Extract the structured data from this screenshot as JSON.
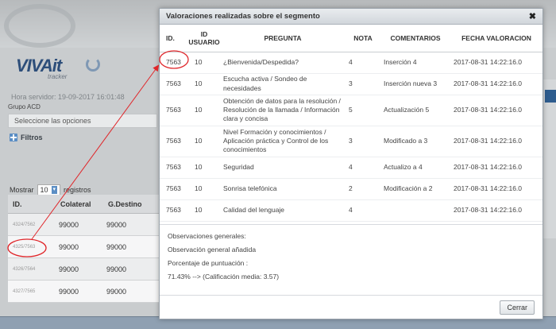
{
  "background": {
    "logo_main": "VIVAit",
    "logo_sub": "tracker",
    "server_time": "Hora servidor: 19-09-2017 16:01:48",
    "group_label": "Grupo ACD",
    "group_placeholder": "Seleccione las opciones",
    "filters_label": "Filtros",
    "show_prefix": "Mostrar",
    "show_value": "10",
    "show_suffix": "registros",
    "table_headers": [
      "ID.",
      "Colateral",
      "G.Destino"
    ],
    "rows": [
      {
        "id": "4324/7562",
        "colateral": "99000",
        "destino": "99000"
      },
      {
        "id": "4325/7563",
        "colateral": "99000",
        "destino": "99000"
      },
      {
        "id": "4326/7564",
        "colateral": "99000",
        "destino": "99000"
      },
      {
        "id": "4327/7565",
        "colateral": "99000",
        "destino": "99000"
      }
    ]
  },
  "modal": {
    "title": "Valoraciones realizadas sobre el segmento",
    "close_icon": "close-icon",
    "headers": {
      "id": "ID.",
      "user": "ID USUARIO",
      "question": "PREGUNTA",
      "nota": "NOTA",
      "comments": "COMENTARIOS",
      "date": "FECHA VALORACION"
    },
    "rows": [
      {
        "id": "7563",
        "user": "10",
        "question": "¿Bienvenida/Despedida?",
        "nota": "4",
        "comment": "Inserción 4",
        "date": "2017-08-31 14:22:16.0"
      },
      {
        "id": "7563",
        "user": "10",
        "question": "Escucha activa / Sondeo de necesidades",
        "nota": "3",
        "comment": "Inserción nueva 3",
        "date": "2017-08-31 14:22:16.0"
      },
      {
        "id": "7563",
        "user": "10",
        "question": "Obtención de datos para la resolución / Resolución de la llamada / Información clara y concisa",
        "nota": "5",
        "comment": "Actualización 5",
        "date": "2017-08-31 14:22:16.0"
      },
      {
        "id": "7563",
        "user": "10",
        "question": "Nivel Formación y conocimientos / Aplicación práctica y Control de los conocimientos",
        "nota": "3",
        "comment": "Modificado a 3",
        "date": "2017-08-31 14:22:16.0"
      },
      {
        "id": "7563",
        "user": "10",
        "question": "Seguridad",
        "nota": "4",
        "comment": "Actualizo a 4",
        "date": "2017-08-31 14:22:16.0"
      },
      {
        "id": "7563",
        "user": "10",
        "question": "Sonrisa telefónica",
        "nota": "2",
        "comment": "Modificación a 2",
        "date": "2017-08-31 14:22:16.0"
      },
      {
        "id": "7563",
        "user": "10",
        "question": "Calidad del lenguaje",
        "nota": "4",
        "comment": "",
        "date": "2017-08-31 14:22:16.0"
      }
    ],
    "observations_label": "Observaciones generales:",
    "observations_text": "Observación general añadida",
    "score_label": "Porcentaje de puntuación :",
    "score_text": "71.43% --> (Calificación media: 3.57)",
    "close_button": "Cerrar"
  },
  "colors": {
    "annotation": "#e0262a",
    "accent": "#2d5c8e"
  }
}
